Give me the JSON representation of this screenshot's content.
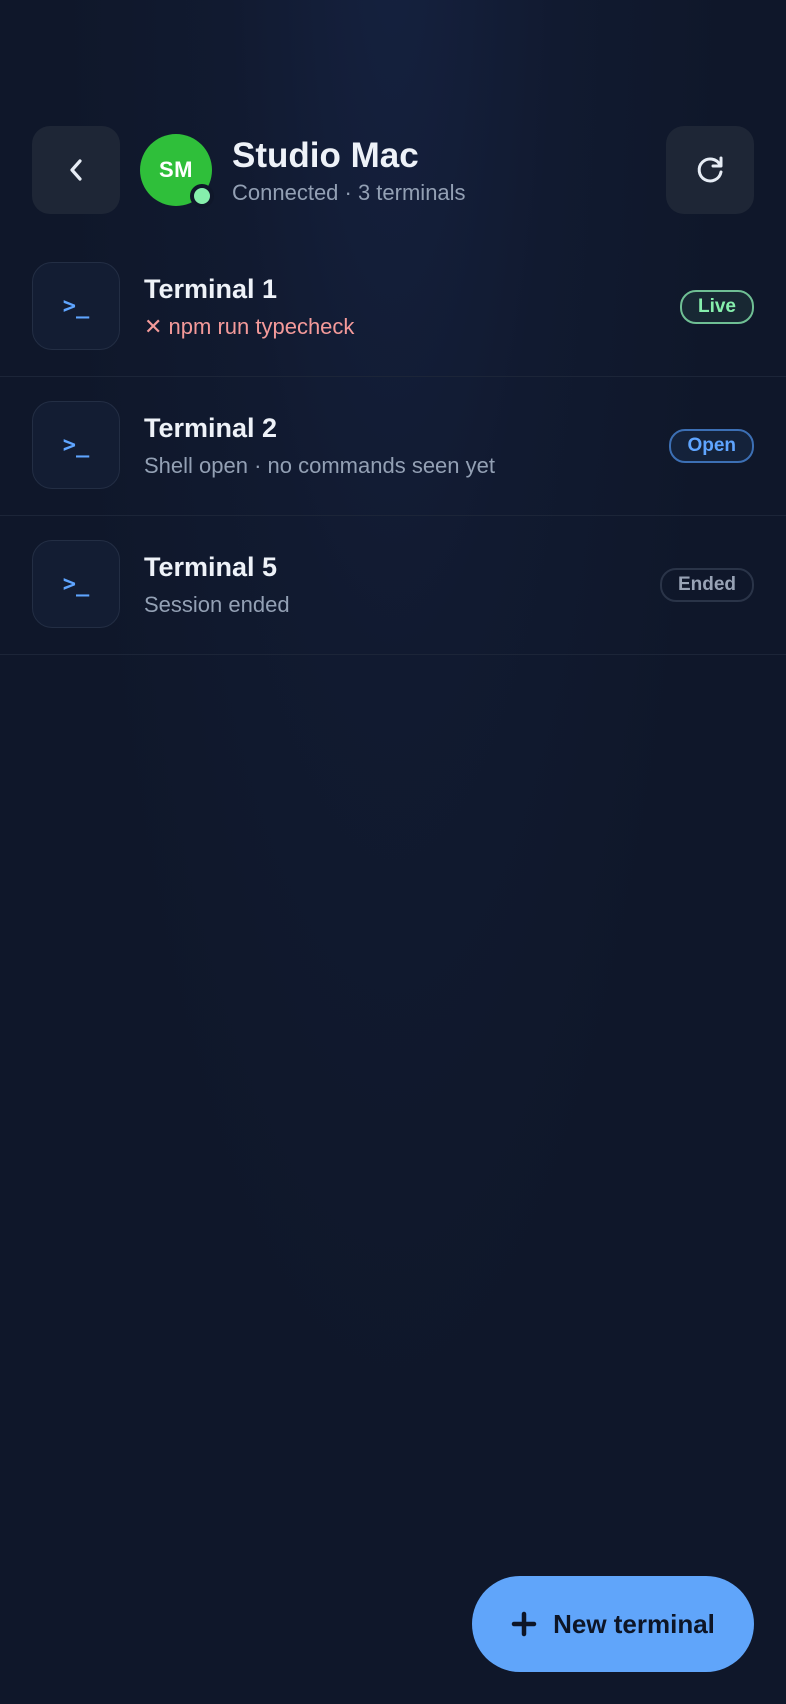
{
  "header": {
    "back_icon": "chevron-left-icon",
    "refresh_icon": "refresh-icon",
    "avatar_initials": "SM",
    "host_name": "Studio Mac",
    "host_subtitle": "Connected · 3 terminals",
    "status_color": "#86efac"
  },
  "terminals": [
    {
      "icon": ">_",
      "title": "Terminal 1",
      "subtitle": "✕ npm run typecheck",
      "subtitle_color": "#f49a9a",
      "badge": "Live"
    },
    {
      "icon": ">_",
      "title": "Terminal 2",
      "subtitle": "Shell open · no commands seen yet",
      "badge": "Open"
    },
    {
      "icon": ">_",
      "title": "Terminal 5",
      "subtitle": "Session ended",
      "badge": "Ended"
    }
  ],
  "fab": {
    "icon": "plus-icon",
    "label": "New terminal"
  },
  "colors": {
    "background": "#0f172a",
    "accent": "#60a5fa",
    "avatar": "#2fbf3a",
    "live": "#86efac",
    "error": "#f49a9a"
  }
}
